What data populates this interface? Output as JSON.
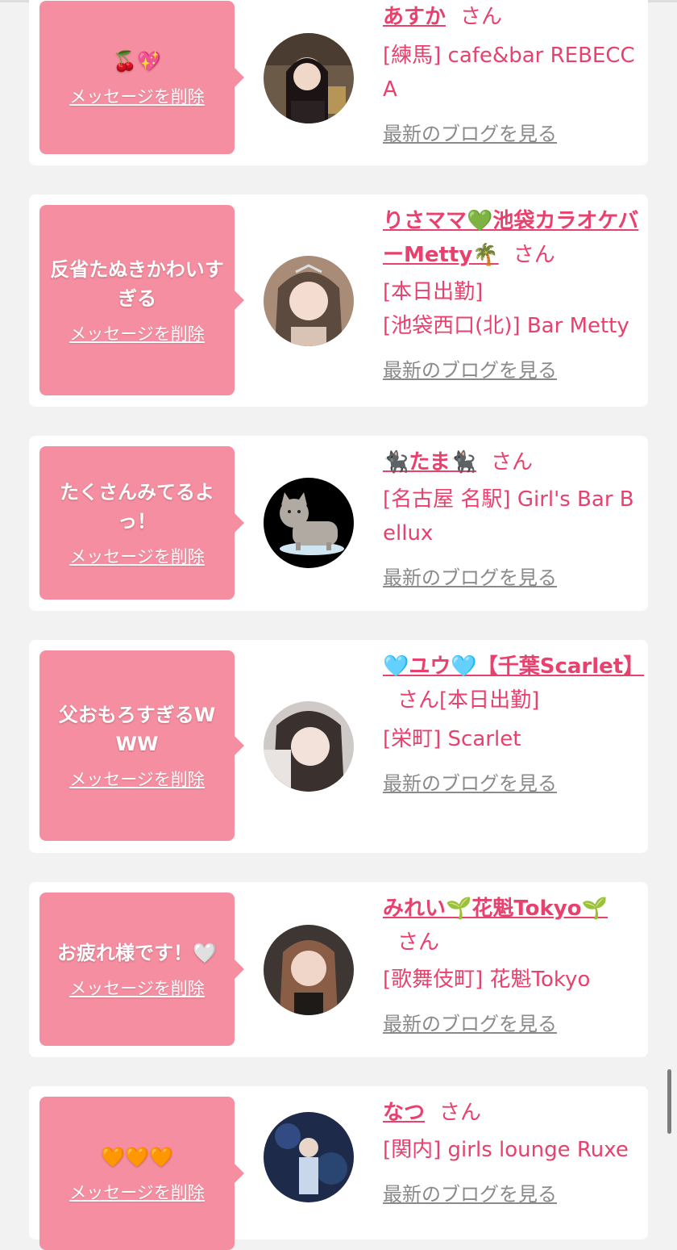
{
  "colors": {
    "bubble": "#f68ea1",
    "name": "#e8416d",
    "blog_link": "#8a8a8a",
    "background": "#f2f2f2"
  },
  "cards": [
    {
      "message": "🍒💖",
      "delete_label": "メッセージを削除",
      "name": "あすか",
      "san": "さん",
      "shop_lines": [
        "[練馬] cafe&bar REBECCA"
      ],
      "blog_label": "最新のブログを見る",
      "avatar": "portrait-photo"
    },
    {
      "message": "反省たぬきかわいすぎる",
      "delete_label": "メッセージを削除",
      "name": "りさママ💚池袋カラオケバーMetty🌴",
      "san": "さん",
      "shop_lines": [
        "[本日出勤]",
        "[池袋西口(北)] Bar Metty"
      ],
      "blog_label": "最新のブログを見る",
      "avatar": "portrait-photo"
    },
    {
      "message": "たくさんみてるよっ！",
      "delete_label": "メッセージを削除",
      "name": "🐈‍⬛たま🐈‍⬛",
      "san": "さん",
      "shop_lines": [
        "[名古屋 名駅] Girl's Bar Bellux"
      ],
      "blog_label": "最新のブログを見る",
      "avatar": "cat-illustration"
    },
    {
      "message": "父おもろすぎるWWW",
      "delete_label": "メッセージを削除",
      "name": "🩵ユウ🩵【千葉Scarlet】",
      "san": "さん",
      "shop_lines": [
        "[本日出勤]",
        "[栄町] Scarlet"
      ],
      "blog_label": "最新のブログを見る",
      "avatar": "portrait-photo"
    },
    {
      "message": "お疲れ様です！🤍",
      "delete_label": "メッセージを削除",
      "name": "みれい🌱花魁Tokyo🌱",
      "san": "さん",
      "shop_lines": [
        "[歌舞伎町] 花魁Tokyo"
      ],
      "blog_label": "最新のブログを見る",
      "avatar": "portrait-photo"
    },
    {
      "message": "🧡🧡🧡",
      "delete_label": "メッセージを削除",
      "name": "なつ",
      "san": "さん",
      "shop_lines": [
        "[関内] girls lounge Ruxe"
      ],
      "blog_label": "最新のブログを見る",
      "avatar": "portrait-photo"
    }
  ]
}
